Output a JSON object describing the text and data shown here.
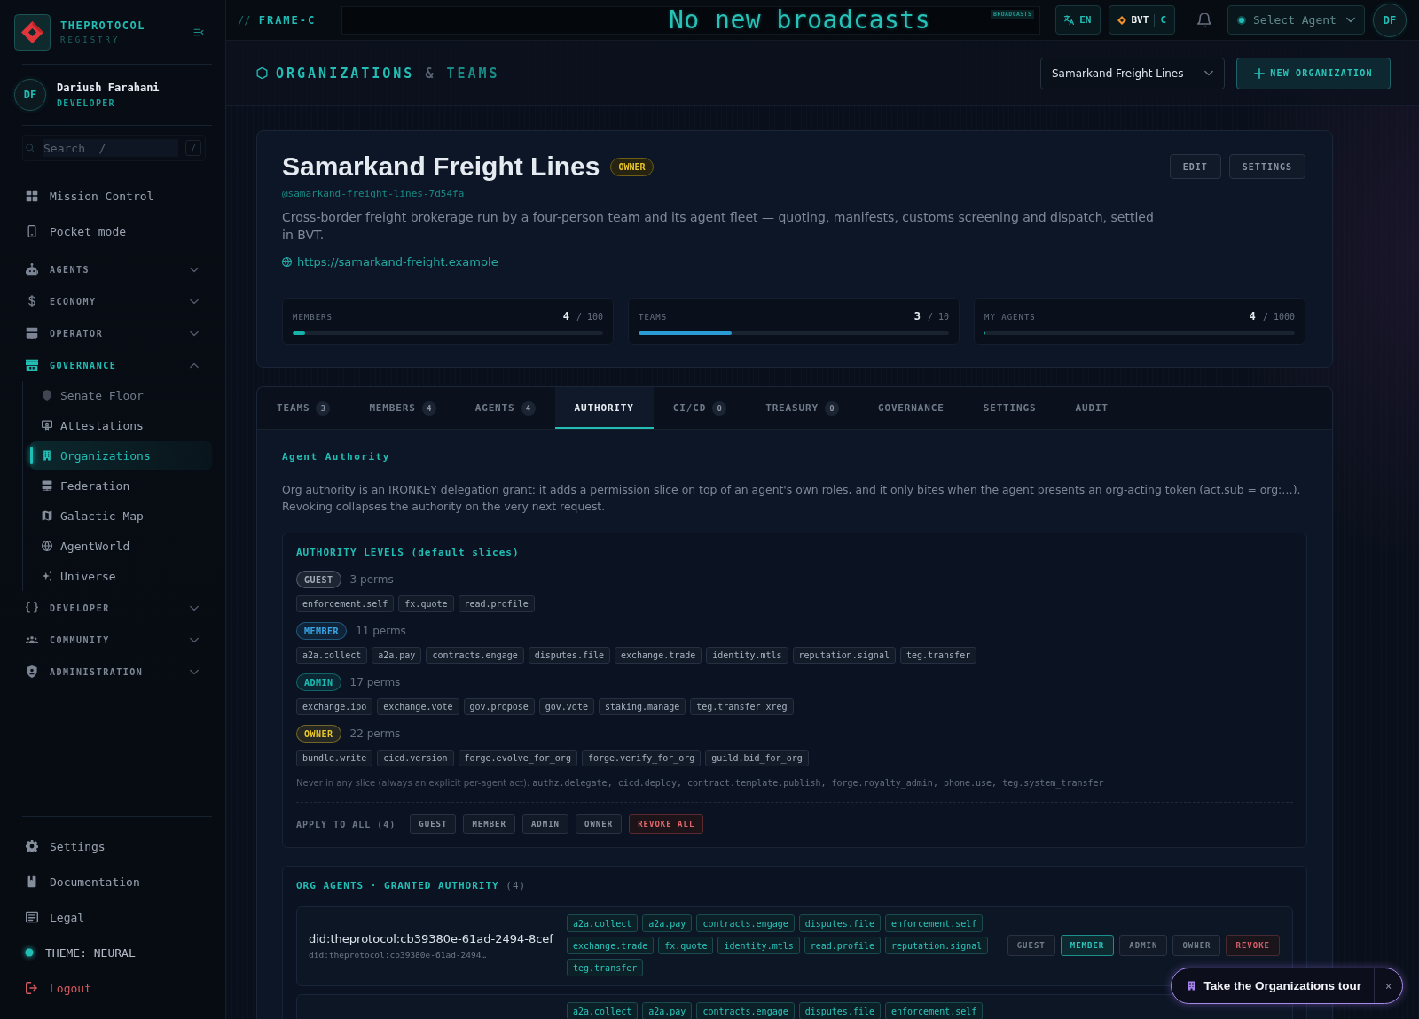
{
  "sidebar": {
    "brand": {
      "name": "THEPROTOCOL",
      "subtitle": "REGISTRY"
    },
    "user": {
      "initials": "DF",
      "name": "Dariush Farahani",
      "role": "DEVELOPER"
    },
    "search": {
      "placeholder": "Search  /",
      "shortcut": "/"
    },
    "nav": [
      {
        "kind": "link",
        "label": "Mission Control",
        "selected": false
      },
      {
        "kind": "link",
        "label": "Pocket mode",
        "selected": false
      },
      {
        "kind": "group",
        "label": "AGENTS",
        "active": false,
        "expanded": false
      },
      {
        "kind": "group",
        "label": "ECONOMY",
        "active": false,
        "expanded": false
      },
      {
        "kind": "group",
        "label": "OPERATOR",
        "active": false,
        "expanded": false
      },
      {
        "kind": "group",
        "label": "GOVERNANCE",
        "active": true,
        "expanded": true,
        "children": [
          {
            "label": "Senate Floor",
            "selected": false,
            "disabled": true
          },
          {
            "label": "Attestations",
            "selected": false,
            "disabled": false
          },
          {
            "label": "Organizations",
            "selected": true,
            "disabled": false
          },
          {
            "label": "Federation",
            "selected": false,
            "disabled": false
          },
          {
            "label": "Galactic Map",
            "selected": false,
            "disabled": false
          },
          {
            "label": "AgentWorld",
            "selected": false,
            "disabled": false
          },
          {
            "label": "Universe",
            "selected": false,
            "disabled": false
          }
        ]
      },
      {
        "kind": "group",
        "label": "DEVELOPER",
        "active": false,
        "expanded": false
      },
      {
        "kind": "group",
        "label": "COMMUNITY",
        "active": false,
        "expanded": false
      },
      {
        "kind": "group",
        "label": "ADMINISTRATION",
        "active": false,
        "expanded": false
      }
    ],
    "footer": [
      {
        "kind": "link",
        "label": "Settings"
      },
      {
        "kind": "link",
        "label": "Documentation"
      },
      {
        "kind": "link",
        "label": "Legal"
      },
      {
        "kind": "theme",
        "label": "THEME: NEURAL"
      },
      {
        "kind": "logout",
        "label": "Logout"
      }
    ]
  },
  "topbar": {
    "frame": {
      "prefix": "//",
      "label": "FRAME-C"
    },
    "ticker": {
      "text": "No new broadcasts",
      "tag": "BROADCASTS"
    },
    "language": "EN",
    "wallet": {
      "code": "BVT",
      "unit": "C"
    },
    "agent_select": {
      "placeholder": "Select Agent"
    },
    "avatar": "DF"
  },
  "header": {
    "title": [
      "ORGANIZATIONS",
      "&",
      "TEAMS"
    ],
    "org_select": {
      "value": "Samarkand Freight Lines"
    },
    "new_button": "NEW ORGANIZATION"
  },
  "org": {
    "name": "Samarkand Freight Lines",
    "role_badge": "OWNER",
    "slug": "@samarkand-freight-lines-7d54fa",
    "description": "Cross-border freight brokerage run by a four-person team and its agent fleet — quoting, manifests, customs screening and dispatch, settled in BVT.",
    "url": "https://samarkand-freight.example",
    "actions": [
      "EDIT",
      "SETTINGS"
    ],
    "stats": [
      {
        "label": "MEMBERS",
        "value": "4",
        "limit": "/ 100",
        "level": 0.04,
        "color": "#17b3ab"
      },
      {
        "label": "TEAMS",
        "value": "3",
        "limit": "/ 10",
        "level": 0.3,
        "color": "#2a9bd4"
      },
      {
        "label": "MY AGENTS",
        "value": "4",
        "limit": "/ 1000",
        "level": 0.004
      }
    ]
  },
  "tabs": [
    {
      "label": "TEAMS",
      "count": "3",
      "selected": false
    },
    {
      "label": "MEMBERS",
      "count": "4",
      "selected": false
    },
    {
      "label": "AGENTS",
      "count": "4",
      "selected": false
    },
    {
      "label": "AUTHORITY",
      "selected": true
    },
    {
      "label": "CI/CD",
      "count": "0",
      "selected": false
    },
    {
      "label": "TREASURY",
      "count": "0",
      "selected": false
    },
    {
      "label": "GOVERNANCE",
      "selected": false
    },
    {
      "label": "SETTINGS",
      "selected": false
    },
    {
      "label": "AUDIT",
      "selected": false
    }
  ],
  "authority": {
    "heading": "Agent Authority",
    "description": "Org authority is an IRONKEY delegation grant: it adds a permission slice on top of an agent's own roles, and it only bites when the agent presents an org-acting token (act.sub = org:…). Revoking collapses the authority on the very next request.",
    "levels_box": {
      "title": "AUTHORITY LEVELS (default slices)",
      "levels": [
        {
          "label": "GUEST",
          "count": "3 perms",
          "color": "#a3abb8",
          "perms": [
            "enforcement.self",
            "fx.quote",
            "read.profile"
          ]
        },
        {
          "label": "MEMBER",
          "count": "11 perms",
          "color": "#3aa6e6",
          "perms": [
            "a2a.collect",
            "a2a.pay",
            "contracts.engage",
            "disputes.file",
            "exchange.trade",
            "identity.mtls",
            "reputation.signal",
            "teg.transfer"
          ]
        },
        {
          "label": "ADMIN",
          "count": "17 perms",
          "color": "#1cbdb4",
          "perms": [
            "exchange.ipo",
            "exchange.vote",
            "gov.propose",
            "gov.vote",
            "staking.manage",
            "teg.transfer_xreg"
          ]
        },
        {
          "label": "OWNER",
          "count": "22 perms",
          "color": "#e8c52a",
          "perms": [
            "bundle.write",
            "cicd.version",
            "forge.evolve_for_org",
            "forge.verify_for_org",
            "guild.bid_for_org"
          ]
        }
      ],
      "never": {
        "label": "Never in any slice (always an explicit per-agent act):",
        "perms": "authz.delegate, cicd.deploy, contract.template.publish, forge.royalty_admin, phone.use, teg.system_transfer"
      },
      "apply": {
        "label": "APPLY TO ALL (4)",
        "buttons": [
          {
            "kind": "level",
            "label": "GUEST"
          },
          {
            "kind": "level",
            "label": "MEMBER"
          },
          {
            "kind": "level",
            "label": "ADMIN"
          },
          {
            "kind": "level",
            "label": "OWNER"
          },
          {
            "kind": "revoke",
            "label": "REVOKE ALL"
          }
        ]
      }
    },
    "agents_box": {
      "title": "ORG AGENTS · GRANTED AUTHORITY",
      "count": "(4)",
      "agents": [
        {
          "did": "did:theprotocol:cb39380e-61ad-2494-8cef",
          "did_short": "did:theprotocol:cb39380e-61ad-2494…",
          "perms": [
            "a2a.collect",
            "a2a.pay",
            "contracts.engage",
            "disputes.file",
            "enforcement.self",
            "exchange.trade",
            "fx.quote",
            "identity.mtls",
            "read.profile",
            "reputation.signal",
            "teg.transfer"
          ],
          "levels": [
            {
              "label": "GUEST",
              "selected": false
            },
            {
              "label": "MEMBER",
              "selected": true
            },
            {
              "label": "ADMIN",
              "selected": false
            },
            {
              "label": "OWNER",
              "selected": false
            }
          ],
          "revoke": "REVOKE"
        },
        {
          "perms": [
            "a2a.collect",
            "a2a.pay",
            "contracts.engage",
            "disputes.file",
            "enforcement.self"
          ]
        }
      ]
    }
  },
  "tour": {
    "label": "Take the Organizations tour",
    "close": "×"
  }
}
